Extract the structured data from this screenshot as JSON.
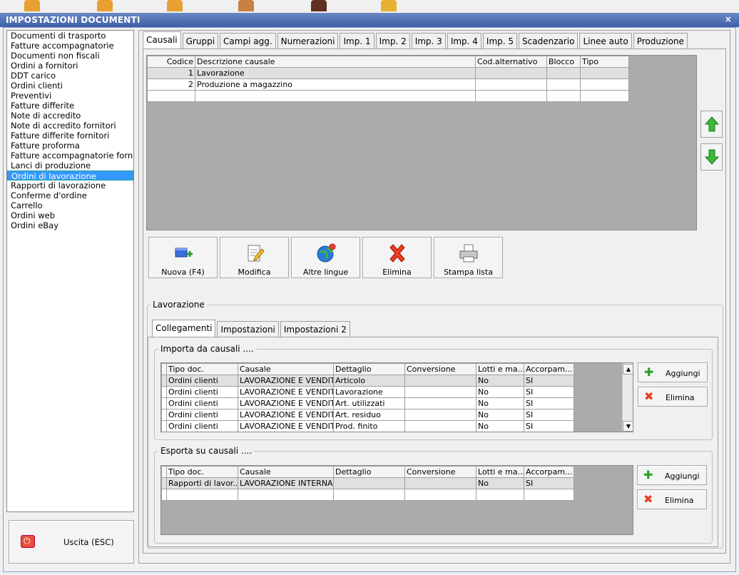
{
  "window": {
    "title": "IMPOSTAZIONI DOCUMENTI",
    "close": "×"
  },
  "documents": [
    "Documenti di trasporto",
    "Fatture accompagnatorie",
    "Documenti non fiscali",
    "Ordini a fornitori",
    "DDT carico",
    "Ordini clienti",
    "Preventivi",
    "Fatture differite",
    "Note di accredito",
    "Note di accredito fornitori",
    "Fatture differite fornitori",
    "Fatture proforma",
    "Fatture accompagnatorie fornit",
    "Lanci di produzione",
    "Ordini di lavorazione",
    "Rapporti di lavorazione",
    "Conferme d'ordine",
    "Carrello",
    "Ordini web",
    "Ordini eBay"
  ],
  "selected_document": "Ordini di lavorazione",
  "exit_label": "Uscita (ESC)",
  "tabs": [
    "Causali",
    "Gruppi",
    "Campi agg.",
    "Numerazioni",
    "Imp. 1",
    "Imp. 2",
    "Imp. 3",
    "Imp. 4",
    "Imp. 5",
    "Scadenzario",
    "Linee auto",
    "Produzione"
  ],
  "causali": {
    "columns": [
      "Codice",
      "Descrizione causale",
      "Cod.alternativo",
      "Blocco",
      "Tipo"
    ],
    "rows": [
      {
        "codice": "1",
        "descrizione": "Lavorazione",
        "cod_alt": "",
        "blocco": "",
        "tipo": ""
      },
      {
        "codice": "2",
        "descrizione": "Produzione a magazzino",
        "cod_alt": "",
        "blocco": "",
        "tipo": ""
      }
    ]
  },
  "toolbar": {
    "nuova": "Nuova (F4)",
    "modifica": "Modifica",
    "lingue": "Altre lingue",
    "elimina": "Elimina",
    "stampa": "Stampa lista"
  },
  "detail": {
    "title": "Lavorazione",
    "subtabs": [
      "Collegamenti",
      "Impostazioni",
      "Impostazioni 2"
    ],
    "importa": {
      "title": "Importa da causali ....",
      "columns": [
        "Tipo doc.",
        "Causale",
        "Dettaglio",
        "Conversione",
        "Lotti e ma...",
        "Accorpam..."
      ],
      "rows": [
        [
          "Ordini clienti",
          "LAVORAZIONE E VENDITA",
          "Articolo",
          "",
          "No",
          "SI"
        ],
        [
          "Ordini clienti",
          "LAVORAZIONE E VENDITA",
          "Lavorazione",
          "",
          "No",
          "SI"
        ],
        [
          "Ordini clienti",
          "LAVORAZIONE E VENDITA",
          "Art. utilizzati",
          "",
          "No",
          "SI"
        ],
        [
          "Ordini clienti",
          "LAVORAZIONE E VENDITA",
          "Art. residuo",
          "",
          "No",
          "SI"
        ],
        [
          "Ordini clienti",
          "LAVORAZIONE E VENDITA",
          "Prod. finito",
          "",
          "No",
          "SI"
        ]
      ],
      "add": "Aggiungi",
      "remove": "Elimina"
    },
    "esporta": {
      "title": "Esporta su causali ....",
      "columns": [
        "Tipo doc.",
        "Causale",
        "Dettaglio",
        "Conversione",
        "Lotti e ma...",
        "Accorpam..."
      ],
      "rows": [
        [
          "Rapporti di lavor...",
          "LAVORAZIONE INTERNA",
          "",
          "",
          "No",
          "SI"
        ]
      ],
      "add": "Aggiungi",
      "remove": "Elimina"
    }
  }
}
